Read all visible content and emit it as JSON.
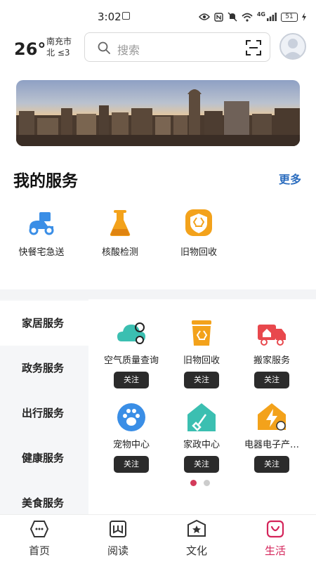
{
  "status_bar": {
    "time": "3:02",
    "network": "4G",
    "battery": "51",
    "icons": [
      "eye-icon",
      "nfc-icon",
      "mute-icon",
      "wifi-icon",
      "signal-icon",
      "battery-icon",
      "charging-icon"
    ]
  },
  "header": {
    "temperature": "26°",
    "city": "南充市",
    "wind": "北 ≤3",
    "search_placeholder": "搜索"
  },
  "my_services": {
    "title": "我的服务",
    "more": "更多",
    "items": [
      {
        "label": "快餐宅急送",
        "icon": "delivery-scooter-icon"
      },
      {
        "label": "核酸检测",
        "icon": "flask-icon"
      },
      {
        "label": "旧物回收",
        "icon": "recycle-badge-icon"
      }
    ]
  },
  "categories": {
    "items": [
      "家居服务",
      "政务服务",
      "出行服务",
      "健康服务",
      "美食服务"
    ],
    "active": "家居服务"
  },
  "service_grid": {
    "follow_label": "关注",
    "items": [
      {
        "name": "空气质量查询",
        "icon": "air-quality-icon"
      },
      {
        "name": "旧物回收",
        "icon": "recycle-bin-icon"
      },
      {
        "name": "搬家服务",
        "icon": "moving-truck-icon"
      },
      {
        "name": "宠物中心",
        "icon": "paw-icon"
      },
      {
        "name": "家政中心",
        "icon": "housekeeping-icon"
      },
      {
        "name": "电器电子产…",
        "icon": "electric-house-icon"
      }
    ],
    "pagination": {
      "pages": 2,
      "current": 1
    }
  },
  "bottom_nav": {
    "tabs": [
      {
        "label": "首页",
        "icon": "home-chat-icon"
      },
      {
        "label": "阅读",
        "icon": "book-icon"
      },
      {
        "label": "文化",
        "icon": "culture-star-icon"
      },
      {
        "label": "生活",
        "icon": "life-bag-icon"
      }
    ],
    "active": "生活"
  },
  "colors": {
    "accent": "#d4245a",
    "more_link": "#2d6ebf",
    "icon_blue": "#3a8ee6",
    "icon_orange": "#f3a21b",
    "icon_teal": "#3bbfb1",
    "icon_red": "#e8484d",
    "follow_button": "#2b2b2b"
  }
}
